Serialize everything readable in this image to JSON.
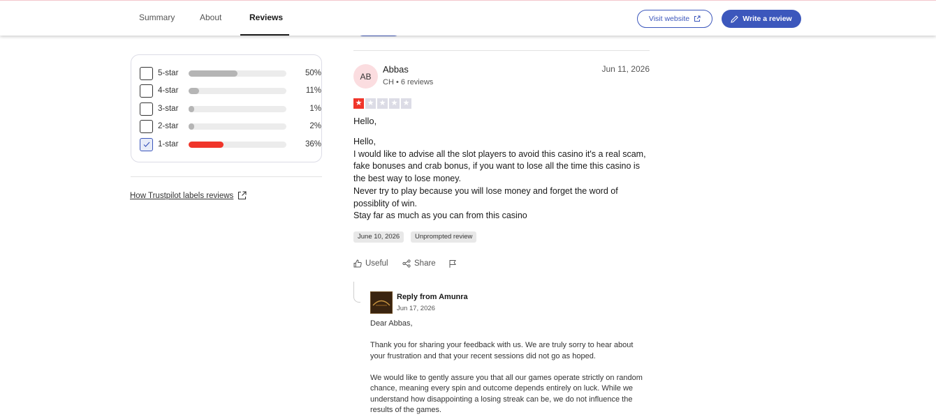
{
  "nav": {
    "tabs": [
      {
        "label": "Summary"
      },
      {
        "label": "About"
      },
      {
        "label": "Reviews"
      }
    ],
    "visit_label": "Visit website",
    "write_label": "Write a review"
  },
  "filters": [
    {
      "label": "5-star",
      "percent_text": "50%",
      "percent": 50,
      "checked": false
    },
    {
      "label": "4-star",
      "percent_text": "11%",
      "percent": 11,
      "checked": false
    },
    {
      "label": "3-star",
      "percent_text": "1%",
      "percent": 1,
      "checked": false
    },
    {
      "label": "2-star",
      "percent_text": "2%",
      "percent": 2,
      "checked": false
    },
    {
      "label": "1-star",
      "percent_text": "36%",
      "percent": 36,
      "checked": true
    }
  ],
  "how_link": "How Trustpilot labels reviews",
  "review": {
    "initials": "AB",
    "name": "Abbas",
    "meta": "CH • 6 reviews",
    "date": "Jun 11, 2026",
    "rating": 1,
    "title": "Hello,",
    "body": [
      "Hello,",
      "I would like to advise all the slot players to avoid this casino it's a real scam, fake bonuses and crab bonus, if you want to lose all the time this casino is the best way to lose money.",
      "Never try to play because you will lose money and forget the word of possiblity of win.",
      "Stay far as much as you can from this casino"
    ],
    "experience_date": "June 10, 2026",
    "tag": "Unprompted review",
    "useful_label": "Useful",
    "share_label": "Share"
  },
  "reply": {
    "from": "Reply from Amunra",
    "date": "Jun 17, 2026",
    "paragraphs": [
      "Dear Abbas,",
      "Thank you for sharing your feedback with us. We are truly sorry to hear about your frustration and that your recent sessions did not go as hoped.",
      "We would like to gently assure you that all our games operate strictly on random chance, meaning every spin and outcome depends entirely on luck. While we understand how disappointing a losing streak can be, we do not influence the results of the games."
    ]
  },
  "colors": {
    "brand_blue": "#3c57bc",
    "star_red": "#f0352a",
    "bar_grey": "#b5b5b5"
  }
}
